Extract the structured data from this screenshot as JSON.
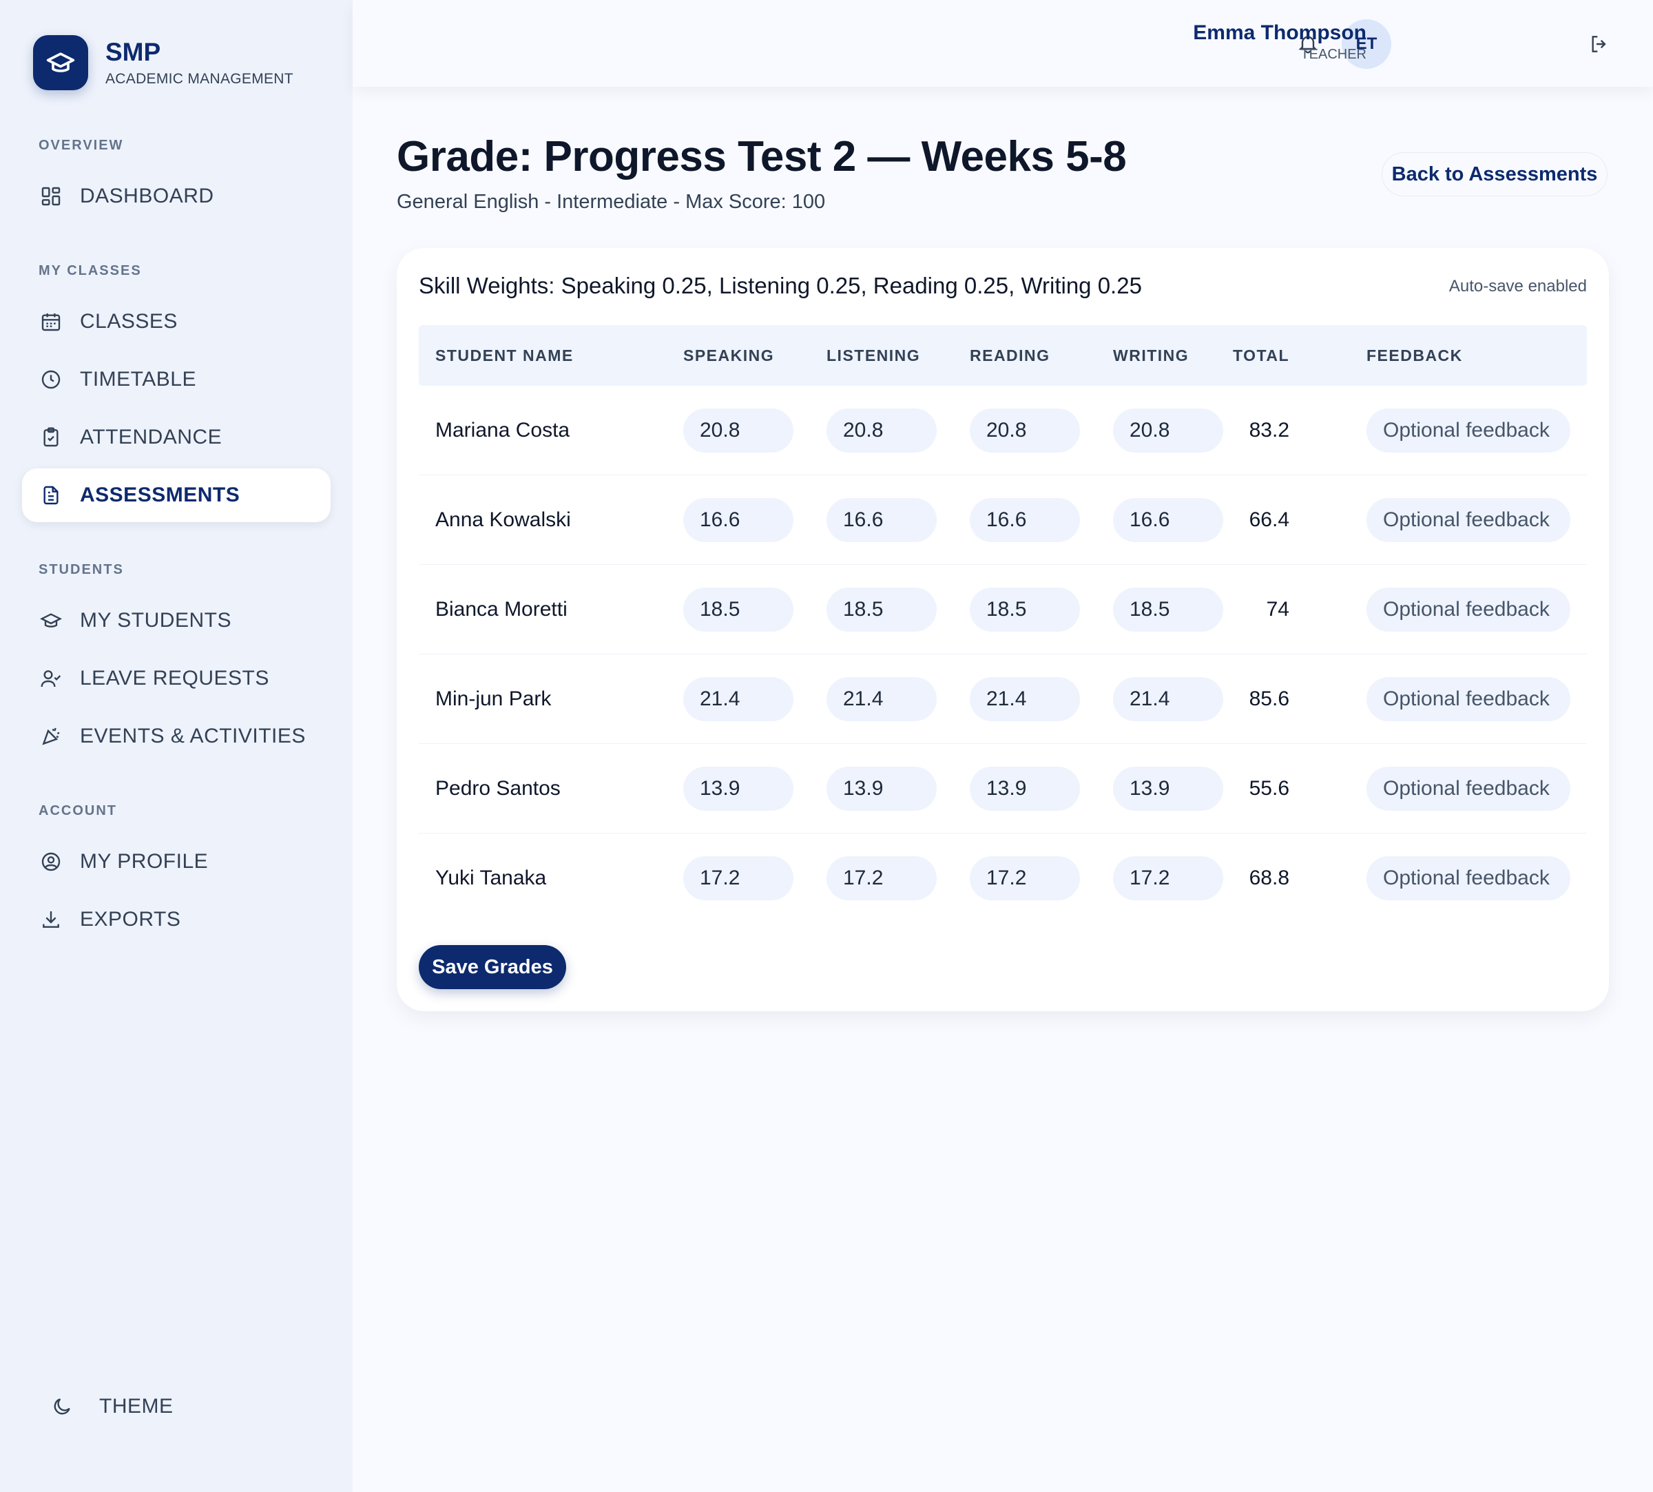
{
  "brand": {
    "name": "SMP",
    "subtitle": "ACADEMIC MANAGEMENT",
    "logo_icon": "graduation-cap-icon"
  },
  "sidebar": {
    "sections": [
      {
        "label": "OVERVIEW",
        "items": [
          {
            "label": "DASHBOARD",
            "icon": "dashboard-icon",
            "active": false
          }
        ]
      },
      {
        "label": "MY CLASSES",
        "items": [
          {
            "label": "CLASSES",
            "icon": "calendar-icon",
            "active": false
          },
          {
            "label": "TIMETABLE",
            "icon": "clock-icon",
            "active": false
          },
          {
            "label": "ATTENDANCE",
            "icon": "clipboard-check-icon",
            "active": false
          },
          {
            "label": "ASSESSMENTS",
            "icon": "document-icon",
            "active": true
          }
        ]
      },
      {
        "label": "STUDENTS",
        "items": [
          {
            "label": "MY STUDENTS",
            "icon": "graduation-cap-icon",
            "active": false
          },
          {
            "label": "LEAVE REQUESTS",
            "icon": "user-check-icon",
            "active": false
          },
          {
            "label": "EVENTS & ACTIVITIES",
            "icon": "party-icon",
            "active": false
          }
        ]
      },
      {
        "label": "ACCOUNT",
        "items": [
          {
            "label": "MY PROFILE",
            "icon": "user-circle-icon",
            "active": false
          },
          {
            "label": "EXPORTS",
            "icon": "download-icon",
            "active": false
          }
        ]
      }
    ],
    "theme_label": "THEME"
  },
  "topbar": {
    "user_initials": "ET",
    "user_name": "Emma Thompson",
    "user_role": "TEACHER"
  },
  "page": {
    "title": "Grade: Progress Test 2 — Weeks 5-8",
    "subtitle": "General English - Intermediate - Max Score: 100",
    "back_label": "Back to Assessments"
  },
  "grading": {
    "weights_text": "Skill Weights: Speaking 0.25, Listening 0.25, Reading 0.25, Writing 0.25",
    "autosave_text": "Auto-save enabled",
    "columns": [
      "STUDENT NAME",
      "SPEAKING",
      "LISTENING",
      "READING",
      "WRITING",
      "TOTAL",
      "FEEDBACK"
    ],
    "feedback_placeholder": "Optional feedback",
    "rows": [
      {
        "name": "Mariana Costa",
        "speaking": "20.8",
        "listening": "20.8",
        "reading": "20.8",
        "writing": "20.8",
        "total": "83.2"
      },
      {
        "name": "Anna Kowalski",
        "speaking": "16.6",
        "listening": "16.6",
        "reading": "16.6",
        "writing": "16.6",
        "total": "66.4"
      },
      {
        "name": "Bianca Moretti",
        "speaking": "18.5",
        "listening": "18.5",
        "reading": "18.5",
        "writing": "18.5",
        "total": "74"
      },
      {
        "name": "Min-jun Park",
        "speaking": "21.4",
        "listening": "21.4",
        "reading": "21.4",
        "writing": "21.4",
        "total": "85.6"
      },
      {
        "name": "Pedro Santos",
        "speaking": "13.9",
        "listening": "13.9",
        "reading": "13.9",
        "writing": "13.9",
        "total": "55.6"
      },
      {
        "name": "Yuki Tanaka",
        "speaking": "17.2",
        "listening": "17.2",
        "reading": "17.2",
        "writing": "17.2",
        "total": "68.8"
      }
    ],
    "save_label": "Save Grades"
  },
  "colors": {
    "primary": "#0d2a6e",
    "sidebar_bg": "#eef2fb",
    "input_bg": "#eef3fd"
  }
}
